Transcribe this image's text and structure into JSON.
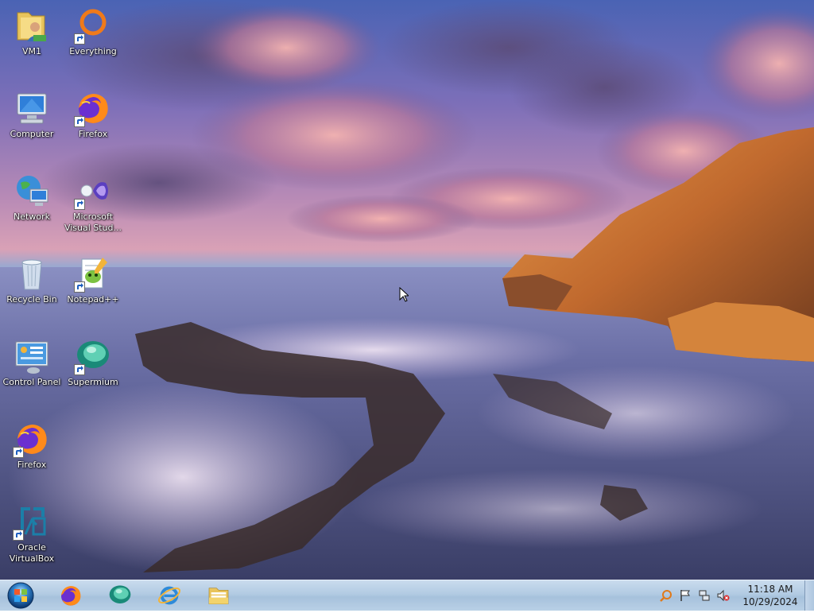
{
  "desktop_icons": [
    {
      "label": "VM1",
      "icon": "folder-user-icon",
      "shortcut": false
    },
    {
      "label": "Everything",
      "icon": "everything-search-icon",
      "shortcut": true
    },
    {
      "label": "Computer",
      "icon": "computer-icon",
      "shortcut": false
    },
    {
      "label": "Firefox",
      "icon": "firefox-icon",
      "shortcut": true
    },
    {
      "label": "Network",
      "icon": "network-globe-icon",
      "shortcut": false
    },
    {
      "label": "Microsoft Visual Stud...",
      "icon": "visual-studio-icon",
      "shortcut": true
    },
    {
      "label": "Recycle Bin",
      "icon": "recycle-bin-icon",
      "shortcut": false
    },
    {
      "label": "Notepad++",
      "icon": "notepad-plus-plus-icon",
      "shortcut": true
    },
    {
      "label": "Control Panel",
      "icon": "control-panel-icon",
      "shortcut": false
    },
    {
      "label": "Supermium",
      "icon": "supermium-icon",
      "shortcut": true
    },
    {
      "label": "Firefox",
      "icon": "firefox-icon",
      "shortcut": true
    },
    {
      "label": "Oracle VirtualBox",
      "icon": "virtualbox-icon",
      "shortcut": true
    }
  ],
  "taskbar": {
    "start_button": "start-orb-icon",
    "pinned": [
      {
        "name": "Firefox",
        "icon": "firefox-icon"
      },
      {
        "name": "Supermium",
        "icon": "supermium-icon"
      },
      {
        "name": "Internet Explorer",
        "icon": "internet-explorer-icon"
      },
      {
        "name": "Windows Explorer",
        "icon": "folder-icon"
      }
    ],
    "tray": {
      "icons": [
        "search-magnifier-icon",
        "action-center-flag-icon",
        "network-icon",
        "volume-muted-icon"
      ],
      "time": "11:18 AM",
      "date": "10/29/2024"
    }
  },
  "colors": {
    "taskbar": "#b2cbe3",
    "label_text": "#ffffff"
  }
}
